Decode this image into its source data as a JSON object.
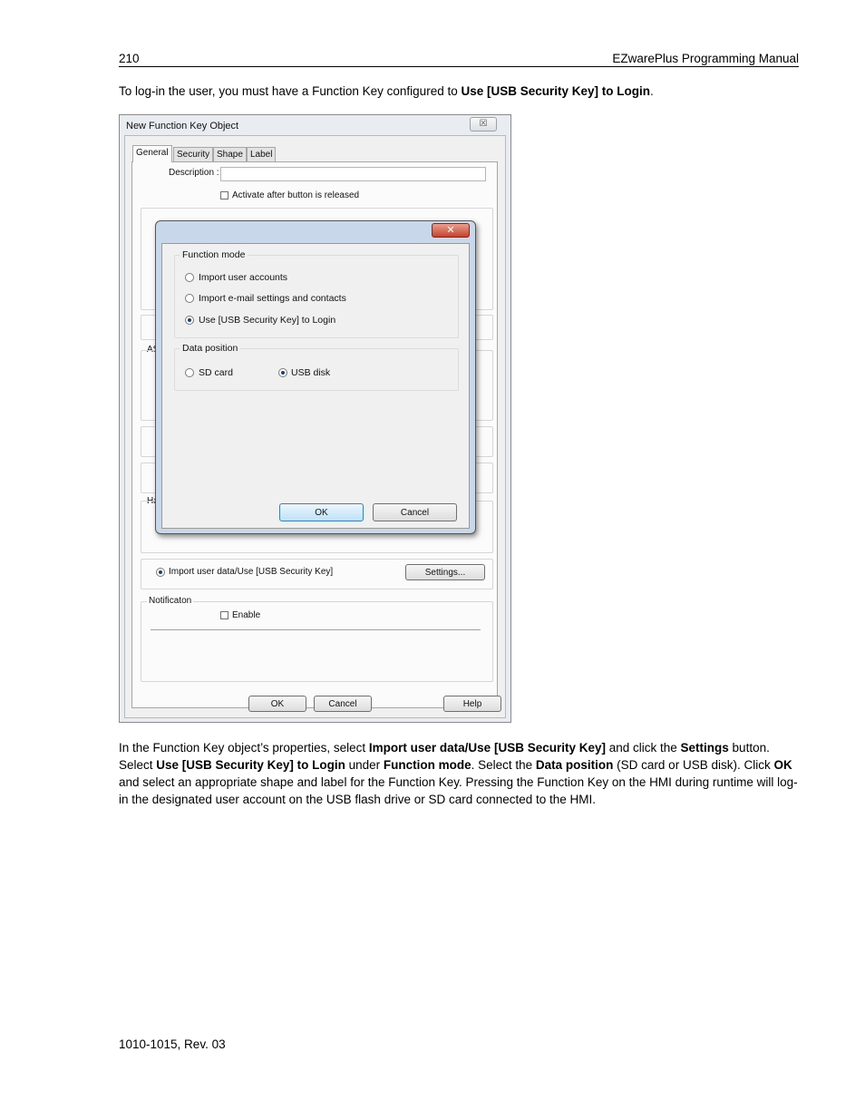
{
  "header": {
    "page_number": "210",
    "manual_title": "EZwarePlus Programming Manual"
  },
  "intro": {
    "text": "To log-in the user, you must have a Function Key configured to ",
    "bold": "Use [USB Security Key] to Login",
    "end": "."
  },
  "window": {
    "title": "New  Function Key Object",
    "close_glyph": "☒",
    "tabs": [
      "General",
      "Security",
      "Shape",
      "Label"
    ],
    "description_label": "Description :",
    "description_value": "",
    "activate_label": "Activate after button is released",
    "partial_label_a": "AS",
    "partial_label_h": "Ha",
    "import_radio_label": "Import user data/Use [USB Security Key]",
    "settings_button": "Settings...",
    "notification_label": "Notificaton",
    "enable_label": "Enable",
    "ok_button": "OK",
    "cancel_button": "Cancel",
    "help_button": "Help"
  },
  "dialog": {
    "close_glyph": "✕",
    "function_mode_label": "Function mode",
    "options": [
      "Import user accounts",
      "Import  e-mail settings and contacts",
      "Use [USB Security Key] to Login"
    ],
    "data_position_label": "Data position",
    "sd_card": "SD card",
    "usb_disk": "USB disk",
    "ok_button": "OK",
    "cancel_button": "Cancel"
  },
  "body_text": {
    "s1": "In the Function Key object’s properties, select ",
    "b1": "Import user data/Use [USB Security Key]",
    "s2": " and click the ",
    "b2": "Settings",
    "s3": " button. Select ",
    "b3": "Use [USB Security Key] to Login",
    "s4": " under ",
    "b4": "Function mode",
    "s5": ". Select the ",
    "b5": "Data position",
    "s6": " (SD card or USB disk). Click ",
    "b6": "OK",
    "s7": " and select an appropriate shape and label for the Function Key. Pressing the Function Key on the HMI during runtime will log-in the designated user account on the USB flash drive or SD card connected to the HMI."
  },
  "footer": {
    "doc_id": "1010-1015, Rev. 03"
  }
}
